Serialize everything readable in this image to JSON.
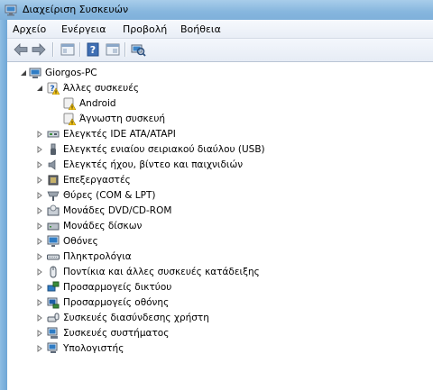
{
  "window": {
    "title": "Διαχείριση Συσκευών"
  },
  "menu": [
    "Αρχείο",
    "Ενέργεια",
    "Προβολή",
    "Βοήθεια"
  ],
  "toolbar": {
    "buttons": [
      "back-arrow-icon",
      "forward-arrow-icon",
      "properties-pane-icon",
      "help-icon",
      "console-tree-icon",
      "scan-hardware-icon"
    ]
  },
  "tree": {
    "root": "Giorgos-PC",
    "other_devices": "Άλλες συσκευές",
    "other_children": [
      "Android",
      "Άγνωστη συσκευή"
    ],
    "categories": [
      "Ελεγκτές IDE ATA/ATAPI",
      "Ελεγκτές ενιαίου σειριακού διαύλου (USB)",
      "Ελεγκτές ήχου, βίντεο και παιχνιδιών",
      "Επεξεργαστές",
      "Θύρες (COM & LPT)",
      "Μονάδες DVD/CD-ROM",
      "Μονάδες δίσκων",
      "Οθόνες",
      "Πληκτρολόγια",
      "Ποντίκια και άλλες συσκευές κατάδειξης",
      "Προσαρμογείς δικτύου",
      "Προσαρμογείς οθόνης",
      "Συσκευές διασύνδεσης χρήστη",
      "Συσκευές συστήματος",
      "Υπολογιστής"
    ]
  }
}
